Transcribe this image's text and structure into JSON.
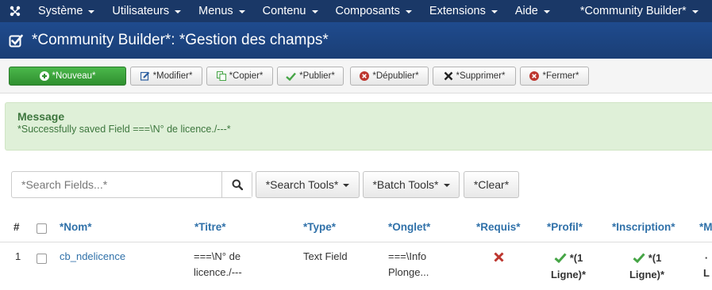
{
  "topnav": {
    "items": [
      {
        "label": "Système"
      },
      {
        "label": "Utilisateurs"
      },
      {
        "label": "Menus"
      },
      {
        "label": "Contenu"
      },
      {
        "label": "Composants"
      },
      {
        "label": "Extensions"
      },
      {
        "label": "Aide"
      },
      {
        "label": "*Community Builder*"
      }
    ]
  },
  "title": "*Community Builder*: *Gestion des champs*",
  "toolbar": {
    "new": "*Nouveau*",
    "edit": "*Modifier*",
    "copy": "*Copier*",
    "publish": "*Publier*",
    "unpublish": "*Dépublier*",
    "delete": "*Supprimer*",
    "close": "*Fermer*"
  },
  "message": {
    "title": "Message",
    "text": "*Successfully saved Field ===\\N° de licence./---*"
  },
  "search": {
    "placeholder": "*Search Fields...*",
    "value": "",
    "search_tools": "*Search Tools*",
    "batch_tools": "*Batch Tools*",
    "clear": "*Clear*"
  },
  "table": {
    "headers": {
      "num": "#",
      "name": "*Nom*",
      "title": "*Titre*",
      "type": "*Type*",
      "tab": "*Onglet*",
      "required": "*Requis*",
      "profile": "*Profil*",
      "registration": "*Inscription*",
      "more": "*M"
    },
    "rows": [
      {
        "num": "1",
        "name": "cb_ndelicence",
        "title_l1": "===\\N° de",
        "title_l2": "licence./---",
        "type": "Text Field",
        "tab_l1": "===\\Info",
        "tab_l2": "Plonge...",
        "required": false,
        "profile_l1": "*(1",
        "profile_l2": "Ligne)*",
        "registration_l1": "*(1",
        "registration_l2": "Ligne)*",
        "more_l1": "·",
        "more_l2": "L"
      }
    ]
  },
  "colors": {
    "topnav_bg": "#1a3867",
    "titlebar_bg": "#1f4b8e",
    "success_bg": "#dff0d8",
    "success_text": "#3c763d",
    "link": "#3071a9",
    "check_green": "#46a546",
    "x_red": "#bd362f"
  }
}
